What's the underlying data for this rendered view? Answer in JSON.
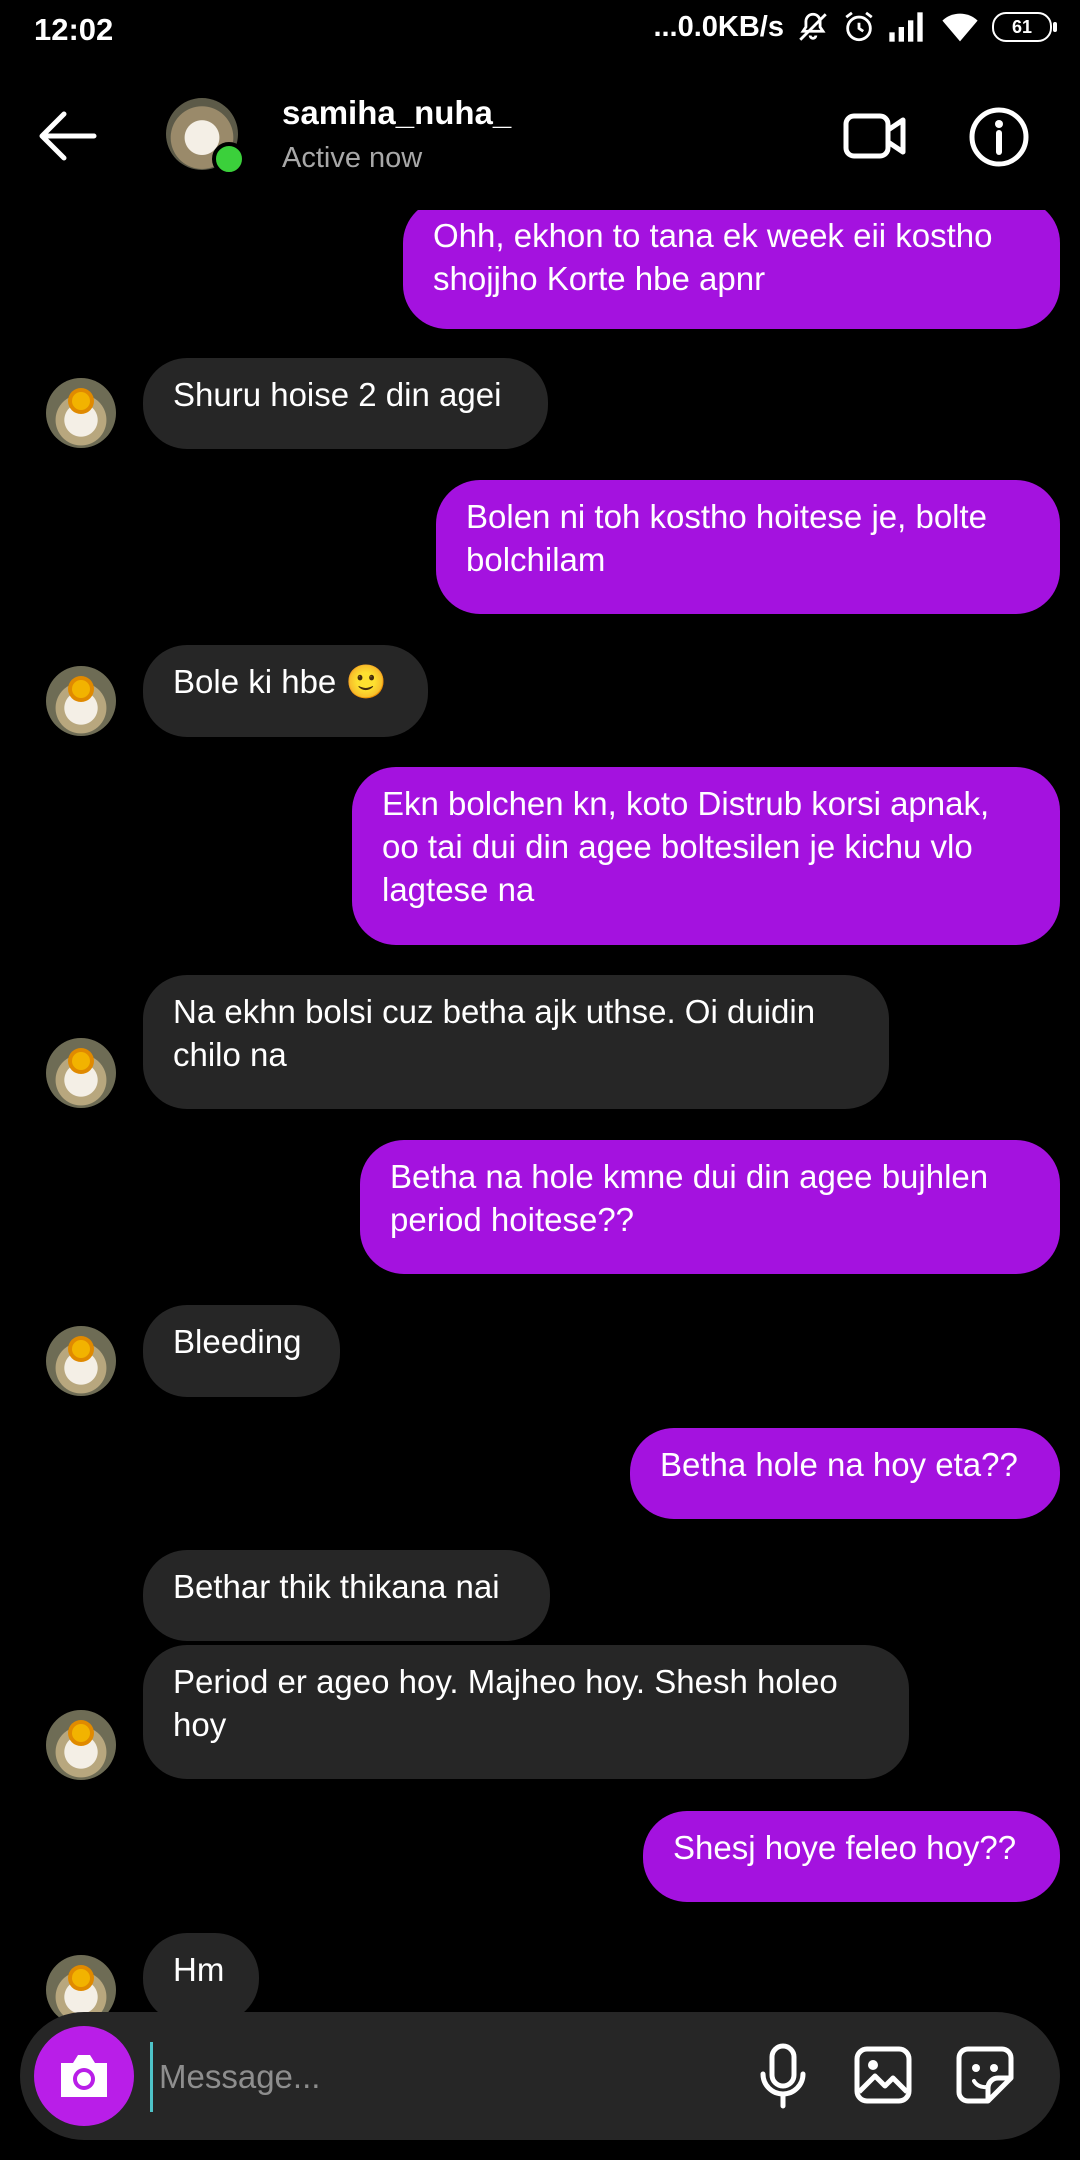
{
  "status_bar": {
    "time": "12:02",
    "network_speed": "...0.0KB/s",
    "battery": "61"
  },
  "header": {
    "contact_name": "samiha_nuha_",
    "contact_status": "Active now"
  },
  "messages": [
    {
      "side": "out",
      "text": "Ohh, ekhon to tana ek week eii kostho\nshojjho Korte hbe apnr"
    },
    {
      "side": "in",
      "text": "Shuru hoise 2 din agei"
    },
    {
      "side": "out",
      "text": "Bolen ni toh kostho hoitese je, bolte\nbolchilam"
    },
    {
      "side": "in",
      "text": "Bole ki hbe 🙂"
    },
    {
      "side": "out",
      "text": "Ekn bolchen kn, koto Distrub korsi apnak,\noo tai dui din agee boltesilen je kichu vlo\nlagtese na"
    },
    {
      "side": "in",
      "text": "Na ekhn bolsi cuz betha ajk uthse. Oi duidin\nchilo na"
    },
    {
      "side": "out",
      "text": "Betha na hole kmne dui din agee bujhlen\nperiod hoitese??"
    },
    {
      "side": "in",
      "text": "Bleeding"
    },
    {
      "side": "out",
      "text": "Betha hole na hoy eta??"
    },
    {
      "side": "in",
      "text": "Bethar thik thikana nai"
    },
    {
      "side": "in",
      "text": "Period er ageo hoy. Majheo hoy. Shesh holeo\nhoy"
    },
    {
      "side": "out",
      "text": "Shesj hoye feleo hoy??"
    },
    {
      "side": "in",
      "text": "Hm"
    }
  ],
  "composer": {
    "placeholder": "Message..."
  },
  "icons": {
    "back": "arrow-left-icon",
    "video": "video-call-icon",
    "info": "info-icon",
    "camera": "camera-icon",
    "mic": "microphone-icon",
    "gallery": "gallery-icon",
    "sticker": "sticker-icon"
  },
  "colors": {
    "outgoing_bubble": "#a412df",
    "incoming_bubble": "#262626",
    "camera_button": "#b91ee8",
    "online": "#3bd03b"
  }
}
